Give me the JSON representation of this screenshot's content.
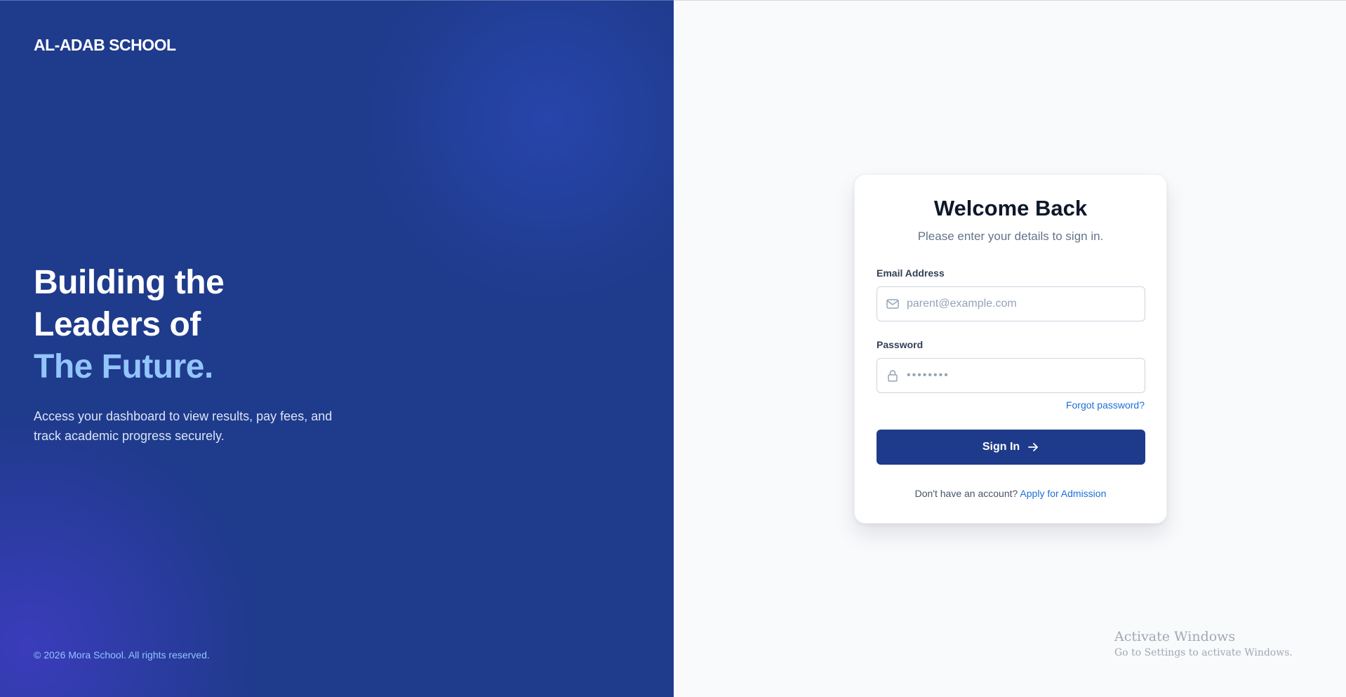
{
  "left_panel": {
    "brand": "AL-ADAB SCHOOL",
    "hero_line1": "Building the",
    "hero_line2": "Leaders of",
    "hero_accent": "The Future.",
    "tagline": "Access your dashboard to view results, pay fees, and track academic progress securely.",
    "copyright": "© 2026 Mora School. All rights reserved."
  },
  "login_card": {
    "title": "Welcome Back",
    "subtitle": "Please enter your details to sign in.",
    "email_label": "Email Address",
    "email_placeholder": "parent@example.com",
    "password_label": "Password",
    "password_placeholder": "••••••••",
    "forgot_link": "Forgot password?",
    "signin_label": "Sign In",
    "no_account_text": "Don't have an account?",
    "apply_link": "Apply for Admission"
  },
  "icons": {
    "email": "mail-icon",
    "password": "lock-icon",
    "signin": "arrow-right-icon"
  },
  "watermark": {
    "line1": "Activate Windows",
    "line2": "Go to Settings to activate Windows."
  },
  "colors": {
    "panel_blue": "#1f3b8c",
    "accent_light_blue": "#93c5fd",
    "button_blue": "#1e3a8a",
    "link_blue": "#1d6fd6"
  }
}
